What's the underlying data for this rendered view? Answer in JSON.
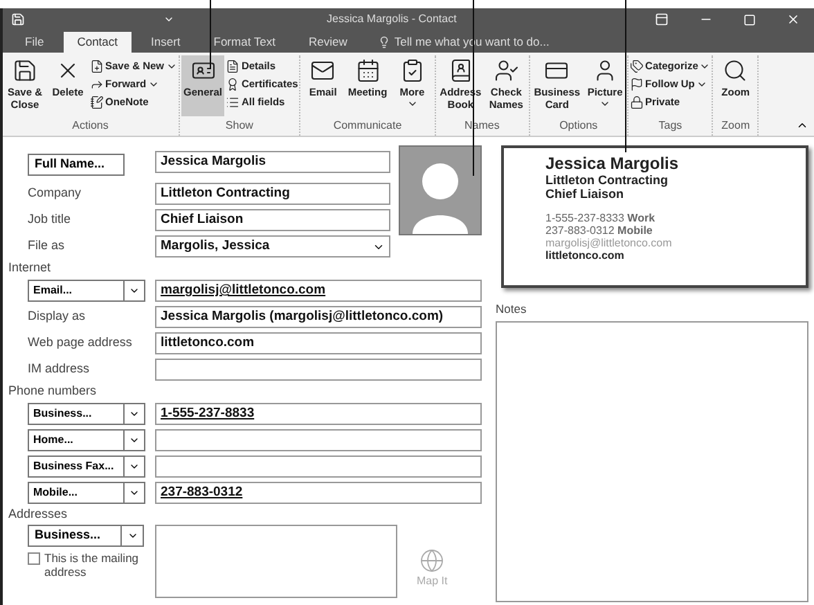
{
  "window": {
    "title": "Jessica Margolis - Contact"
  },
  "tabs": [
    {
      "label": "File",
      "selected": false
    },
    {
      "label": "Contact",
      "selected": true
    },
    {
      "label": "Insert",
      "selected": false
    },
    {
      "label": "Format Text",
      "selected": false
    },
    {
      "label": "Review",
      "selected": false
    }
  ],
  "tell_me": {
    "placeholder": "Tell me what you want to do..."
  },
  "ribbon": {
    "groups": [
      {
        "label": "Actions",
        "buttons": [
          {
            "kind": "large",
            "label": "Save & Close",
            "dropdown": false
          },
          {
            "kind": "large",
            "label": "Delete",
            "dropdown": false
          },
          {
            "kind": "small",
            "label": "Save & New",
            "dropdown": true
          },
          {
            "kind": "small",
            "label": "Forward",
            "dropdown": true
          },
          {
            "kind": "small",
            "label": "OneNote",
            "dropdown": false
          }
        ]
      },
      {
        "label": "Show",
        "buttons": [
          {
            "kind": "large",
            "label": "General",
            "dropdown": false,
            "selected": true
          },
          {
            "kind": "small",
            "label": "Details",
            "dropdown": false,
            "selected": false
          },
          {
            "kind": "small",
            "label": "Certificates",
            "dropdown": false,
            "selected": false
          },
          {
            "kind": "small",
            "label": "All fields",
            "dropdown": false,
            "selected": false
          }
        ]
      },
      {
        "label": "Communicate",
        "buttons": [
          {
            "kind": "large",
            "label": "Email",
            "dropdown": false
          },
          {
            "kind": "large",
            "label": "Meeting",
            "dropdown": false
          },
          {
            "kind": "large",
            "label": "More",
            "dropdown": true
          }
        ]
      },
      {
        "label": "Names",
        "buttons": [
          {
            "kind": "large",
            "label": "Address Book",
            "dropdown": false
          },
          {
            "kind": "large",
            "label": "Check Names",
            "dropdown": false
          }
        ]
      },
      {
        "label": "Options",
        "buttons": [
          {
            "kind": "large",
            "label": "Business Card",
            "dropdown": false
          },
          {
            "kind": "large",
            "label": "Picture",
            "dropdown": true
          }
        ]
      },
      {
        "label": "Tags",
        "buttons": [
          {
            "kind": "small",
            "label": "Categorize",
            "dropdown": true
          },
          {
            "kind": "small",
            "label": "Follow Up",
            "dropdown": true
          },
          {
            "kind": "small",
            "label": "Private",
            "dropdown": false
          }
        ]
      },
      {
        "label": "Zoom",
        "buttons": [
          {
            "kind": "large",
            "label": "Zoom",
            "dropdown": false
          }
        ]
      }
    ]
  },
  "name_section": [
    {
      "kind": "button",
      "label": "Full Name...",
      "value": "Jessica Margolis",
      "link": false
    },
    {
      "kind": "label",
      "label": "Company",
      "value": "Littleton Contracting",
      "link": false
    },
    {
      "kind": "label",
      "label": "Job title",
      "value": "Chief Liaison",
      "link": false
    },
    {
      "kind": "select",
      "label": "File as",
      "value": "Margolis, Jessica",
      "link": false
    }
  ],
  "sections": [
    {
      "heading": "Internet",
      "rows": [
        {
          "kind": "menu",
          "label": "Email...",
          "value": "margolisj@littletonco.com",
          "link": true
        },
        {
          "kind": "label",
          "label": "Display as",
          "value": "Jessica Margolis (margolisj@littletonco.com)",
          "link": false
        },
        {
          "kind": "label",
          "label": "Web page address",
          "value": "littletonco.com",
          "link": false
        },
        {
          "kind": "label",
          "label": "IM address"
        }
      ]
    },
    {
      "heading": "Phone numbers",
      "rows": [
        {
          "kind": "menu",
          "label": "Business...",
          "value": "1-555-237-8833",
          "link": true
        },
        {
          "kind": "menu",
          "label": "Home..."
        },
        {
          "kind": "menu",
          "label": "Business Fax..."
        },
        {
          "kind": "menu",
          "label": "Mobile...",
          "value": "237-883-0312",
          "link": true
        }
      ]
    }
  ],
  "addresses": {
    "heading": "Addresses",
    "type_button": {
      "label": "Business..."
    },
    "mailing": {
      "label": "This is the mailing address",
      "checked": false
    },
    "map_it": {
      "label": "Map It",
      "disabled": true
    }
  },
  "card": {
    "name": "Jessica Margolis",
    "company": "Littleton Contracting",
    "job_title": "Chief Liaison",
    "details": [
      {
        "kind": "phone",
        "text": "1-555-237-8333 **Work**"
      },
      {
        "kind": "phone",
        "text": "237-883-0312 **Mobile**"
      },
      {
        "kind": "email",
        "text": "margolisj@littletonco.com"
      },
      {
        "kind": "web",
        "text": "littletonco.com"
      }
    ]
  },
  "notes": {
    "label": "Notes"
  }
}
